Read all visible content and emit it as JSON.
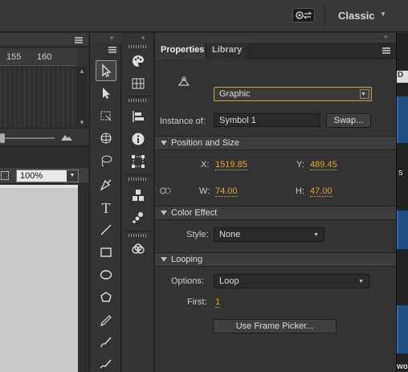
{
  "workspace": {
    "name": "Classic",
    "switcher_icon": "workspace-switch-icon"
  },
  "timeline": {
    "frame_numbers": [
      "155",
      "160"
    ]
  },
  "stage": {
    "zoom": "100%"
  },
  "tools": [
    "selection-arrow",
    "subselection-arrow",
    "free-transform",
    "3d-rotation",
    "lasso",
    "pen",
    "text",
    "line",
    "rectangle",
    "oval",
    "polystar",
    "pencil",
    "brush",
    "paint-brush"
  ],
  "dock": [
    "color-palette",
    "swatches-grid",
    "align",
    "info",
    "transform",
    "components",
    "motion-presets",
    "cc-libraries"
  ],
  "properties": {
    "tabs": [
      "Properties",
      "Library"
    ],
    "symbol_type": "Graphic",
    "instance_of_label": "Instance of:",
    "instance_of_value": "Symbol 1",
    "swap_label": "Swap...",
    "position_size": {
      "title": "Position and Size",
      "x_label": "X:",
      "x_value": "1519.85",
      "y_label": "Y:",
      "y_value": "489.45",
      "w_label": "W:",
      "w_value": "74.00",
      "h_label": "H:",
      "h_value": "47.00"
    },
    "color_effect": {
      "title": "Color Effect",
      "style_label": "Style:",
      "style_value": "None"
    },
    "looping": {
      "title": "Looping",
      "options_label": "Options:",
      "options_value": "Loop",
      "first_label": "First:",
      "first_value": "1",
      "frame_picker_label": "Use Frame Picker..."
    }
  },
  "right_edge": {
    "box_top": "D",
    "letter_mid": "s",
    "bottom_text": "wo"
  }
}
